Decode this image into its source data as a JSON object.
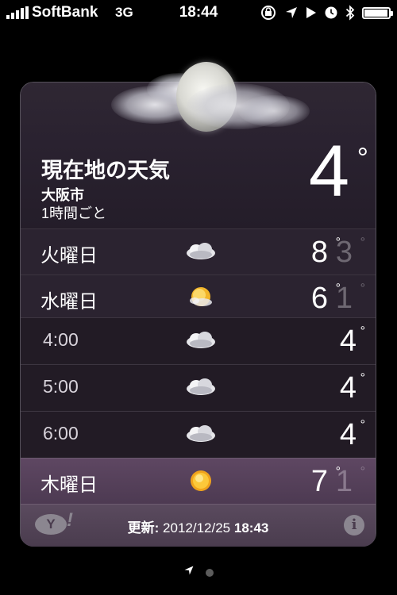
{
  "status": {
    "carrier": "SoftBank",
    "network": "3G",
    "time": "18:44",
    "icons": [
      "rotation-lock-icon",
      "location-arrow-icon",
      "play-icon",
      "alarm-clock-icon",
      "bluetooth-icon",
      "battery-icon"
    ],
    "battery_level": 0.9
  },
  "header": {
    "title": "現在地の天気",
    "city": "大阪市",
    "mode": "1時間ごと",
    "temp": "4",
    "deg": "°",
    "icon": "moon-cloud-icon"
  },
  "forecast": [
    {
      "label": "火曜日",
      "icon": "cloudy-icon",
      "hi": "8",
      "lo": "3"
    },
    {
      "label": "水曜日",
      "icon": "partly-sunny-icon",
      "hi": "6",
      "lo": "1"
    }
  ],
  "hourly": [
    {
      "label": "4:00",
      "icon": "cloudy-icon",
      "temp": "4"
    },
    {
      "label": "5:00",
      "icon": "cloudy-icon",
      "temp": "4"
    },
    {
      "label": "6:00",
      "icon": "cloudy-icon",
      "temp": "4"
    }
  ],
  "next_day": {
    "label": "木曜日",
    "icon": "sunny-icon",
    "hi": "7",
    "lo": "1"
  },
  "footer": {
    "logo": "Y!",
    "updated_label": "更新:",
    "updated_date": "2012/12/25",
    "updated_time": "18:43",
    "info_label": "i"
  },
  "deg": "°"
}
